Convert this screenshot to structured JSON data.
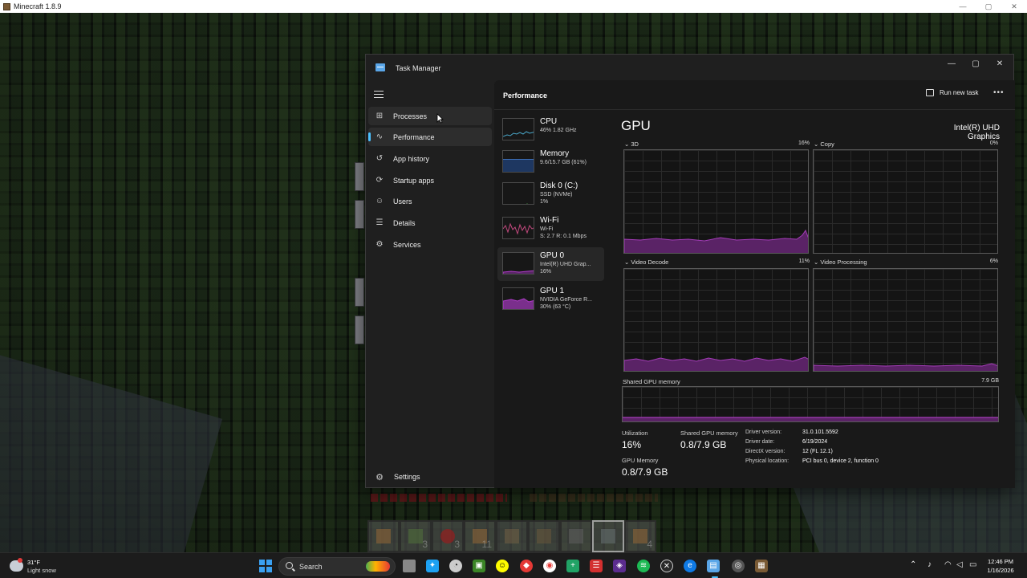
{
  "minecraft": {
    "window_title": "Minecraft 1.8.9",
    "hotbar_counts": [
      "3",
      "3",
      "11",
      "4"
    ]
  },
  "taskmanager": {
    "title": "Task Manager",
    "nav": [
      {
        "label": "Processes",
        "icon": "processes-icon"
      },
      {
        "label": "Performance",
        "icon": "performance-icon"
      },
      {
        "label": "App history",
        "icon": "app-history-icon"
      },
      {
        "label": "Startup apps",
        "icon": "startup-apps-icon"
      },
      {
        "label": "Users",
        "icon": "users-icon"
      },
      {
        "label": "Details",
        "icon": "details-icon"
      },
      {
        "label": "Services",
        "icon": "services-icon"
      }
    ],
    "settings_label": "Settings",
    "header": "Performance",
    "run_task_label": "Run new task",
    "devices": [
      {
        "name": "CPU",
        "sub1": "46% 1.82 GHz",
        "sub2": "",
        "color": "#4aa7c9"
      },
      {
        "name": "Memory",
        "sub1": "9.6/15.7 GB (61%)",
        "sub2": "",
        "color": "#3b6db5"
      },
      {
        "name": "Disk 0 (C:)",
        "sub1": "SSD (NVMe)",
        "sub2": "1%",
        "color": "#4caf50"
      },
      {
        "name": "Wi-Fi",
        "sub1": "Wi-Fi",
        "sub2": "S: 2.7 R: 0.1 Mbps",
        "color": "#c2497e"
      },
      {
        "name": "GPU 0",
        "sub1": "Intel(R) UHD Grap...",
        "sub2": "16%",
        "color": "#b03cc9"
      },
      {
        "name": "GPU 1",
        "sub1": "NVIDIA GeForce R...",
        "sub2": "30% (63 °C)",
        "color": "#b03cc9"
      }
    ],
    "gpu": {
      "title": "GPU",
      "model": "Intel(R) UHD Graphics",
      "engines": [
        {
          "label": "3D",
          "pct": "16%"
        },
        {
          "label": "Copy",
          "pct": "0%"
        },
        {
          "label": "Video Decode",
          "pct": "11%"
        },
        {
          "label": "Video Processing",
          "pct": "6%"
        }
      ],
      "shared_label": "Shared GPU memory",
      "shared_max": "7.9 GB",
      "utilization_label": "Utilization",
      "utilization_value": "16%",
      "shared_mem_label": "Shared GPU memory",
      "shared_mem_value": "0.8/7.9 GB",
      "gpu_mem_label": "GPU Memory",
      "gpu_mem_value": "0.8/7.9 GB",
      "info": [
        {
          "k": "Driver version:",
          "v": "31.0.101.5592"
        },
        {
          "k": "Driver date:",
          "v": "6/19/2024"
        },
        {
          "k": "DirectX version:",
          "v": "12 (FL 12.1)"
        },
        {
          "k": "Physical location:",
          "v": "PCI bus 0, device 2, function 0"
        }
      ],
      "graph_color": "#a43cb8"
    }
  },
  "taskbar": {
    "temp": "31°F",
    "weather": "Light snow",
    "search_label": "Search",
    "time": "12:46 PM",
    "date": "1/16/2026"
  }
}
